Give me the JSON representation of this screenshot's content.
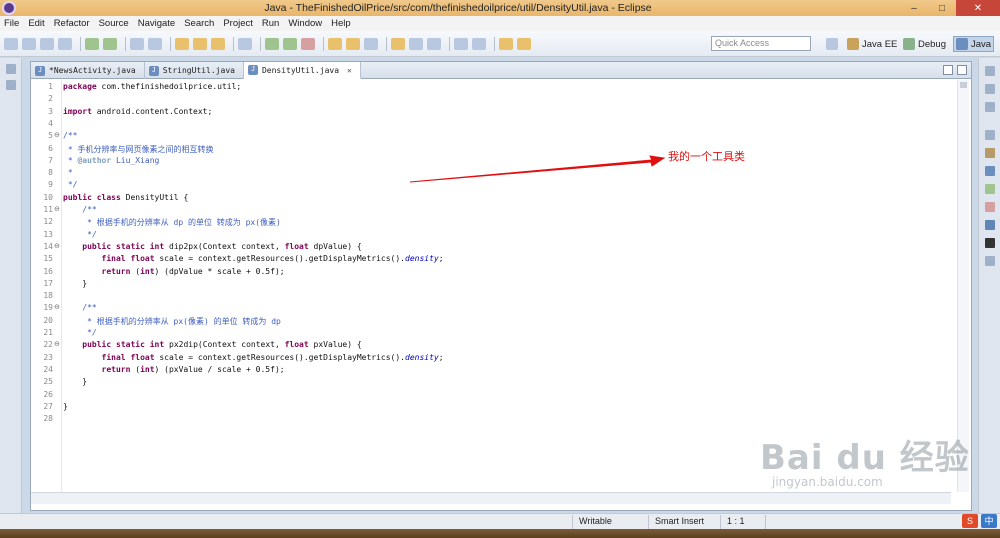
{
  "window": {
    "title": "Java - TheFinishedOilPrice/src/com/thefinishedoilprice/util/DensityUtil.java - Eclipse",
    "minimize": "–",
    "maximize": "□",
    "close": "✕"
  },
  "menu": [
    "File",
    "Edit",
    "Refactor",
    "Source",
    "Navigate",
    "Search",
    "Project",
    "Run",
    "Window",
    "Help"
  ],
  "toolbar": {
    "quick_access_placeholder": "Quick Access",
    "perspectives": [
      "Java EE",
      "Debug",
      "Java"
    ]
  },
  "tabs": [
    {
      "label": "*NewsActivity.java",
      "active": false,
      "closable": false
    },
    {
      "label": "StringUtil.java",
      "active": false,
      "closable": false
    },
    {
      "label": "DensityUtil.java",
      "active": true,
      "closable": true
    }
  ],
  "code": {
    "lines": [
      {
        "n": "1",
        "text": "package com.thefinishedoilprice.util;"
      },
      {
        "n": "2",
        "text": ""
      },
      {
        "n": "3",
        "text": "import android.content.Context;"
      },
      {
        "n": "4",
        "text": ""
      },
      {
        "n": "5",
        "text": "/**"
      },
      {
        "n": "6",
        "text": " * 手机分辨率与网页像素之间的相互转换"
      },
      {
        "n": "7",
        "text": " * @author Liu_Xiang"
      },
      {
        "n": "8",
        "text": " *"
      },
      {
        "n": "9",
        "text": " */"
      },
      {
        "n": "10",
        "text": "public class DensityUtil {"
      },
      {
        "n": "11",
        "text": "    /**"
      },
      {
        "n": "12",
        "text": "     * 根据手机的分辨率从 dp 的单位 转成为 px(像素)"
      },
      {
        "n": "13",
        "text": "     */"
      },
      {
        "n": "14",
        "text": "    public static int dip2px(Context context, float dpValue) {"
      },
      {
        "n": "15",
        "text": "        final float scale = context.getResources().getDisplayMetrics().density;"
      },
      {
        "n": "16",
        "text": "        return (int) (dpValue * scale + 0.5f);"
      },
      {
        "n": "17",
        "text": "    }"
      },
      {
        "n": "18",
        "text": ""
      },
      {
        "n": "19",
        "text": "    /**"
      },
      {
        "n": "20",
        "text": "     * 根据手机的分辨率从 px(像素) 的单位 转成为 dp"
      },
      {
        "n": "21",
        "text": "     */"
      },
      {
        "n": "22",
        "text": "    public static int px2dip(Context context, float pxValue) {"
      },
      {
        "n": "23",
        "text": "        final float scale = context.getResources().getDisplayMetrics().density;"
      },
      {
        "n": "24",
        "text": "        return (int) (pxValue / scale + 0.5f);"
      },
      {
        "n": "25",
        "text": "    }"
      },
      {
        "n": "26",
        "text": ""
      },
      {
        "n": "27",
        "text": "}"
      },
      {
        "n": "28",
        "text": ""
      }
    ]
  },
  "annotation": {
    "text": "我的一个工具类",
    "color": "#e01010"
  },
  "status": {
    "writable": "Writable",
    "insert_mode": "Smart Insert",
    "position": "1 : 1"
  },
  "watermark": {
    "brand": "Bai du 经验",
    "url": "jingyan.baidu.com"
  },
  "tray": {
    "ime_label": "中"
  }
}
